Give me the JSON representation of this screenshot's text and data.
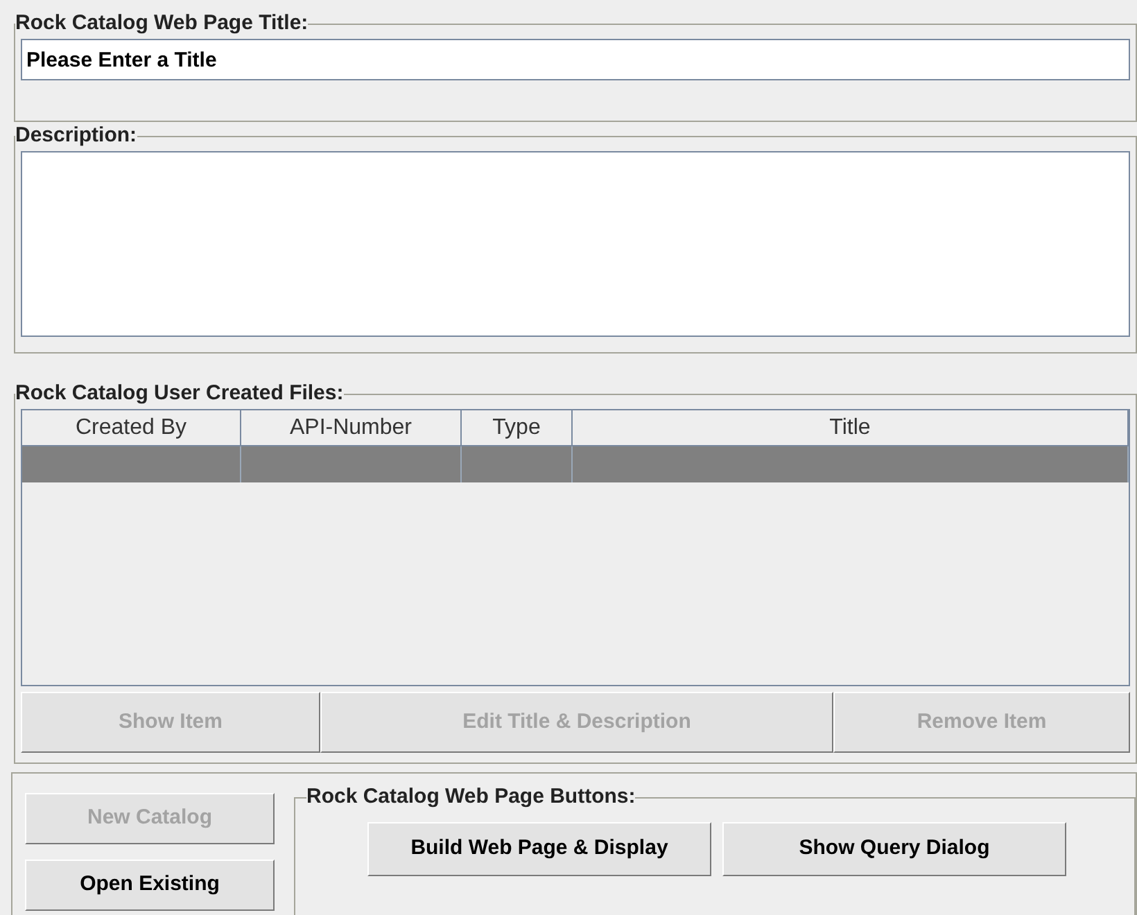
{
  "title_group": {
    "label": "Rock Catalog Web Page Title:",
    "value": "Please Enter a Title"
  },
  "description_group": {
    "label": "Description:"
  },
  "files_group": {
    "label": "Rock Catalog User Created Files:",
    "table": {
      "columns": [
        "Created By",
        "API-Number",
        "Type",
        "Title"
      ],
      "rows": [
        {
          "selected": true
        }
      ]
    },
    "buttons": [
      {
        "label": "Show Item",
        "disabled": true
      },
      {
        "label": "Edit Title & Description",
        "disabled": true
      },
      {
        "label": "Remove Item",
        "disabled": true
      }
    ]
  },
  "catalog_buttons": [
    {
      "label": "New Catalog",
      "disabled": true
    },
    {
      "label": "Open Existing",
      "disabled": false
    }
  ],
  "web_page_group": {
    "label": "Rock Catalog Web Page Buttons:",
    "buttons": [
      {
        "label": "Build Web Page & Display",
        "disabled": false
      },
      {
        "label": "Show Query Dialog",
        "disabled": false
      }
    ]
  }
}
